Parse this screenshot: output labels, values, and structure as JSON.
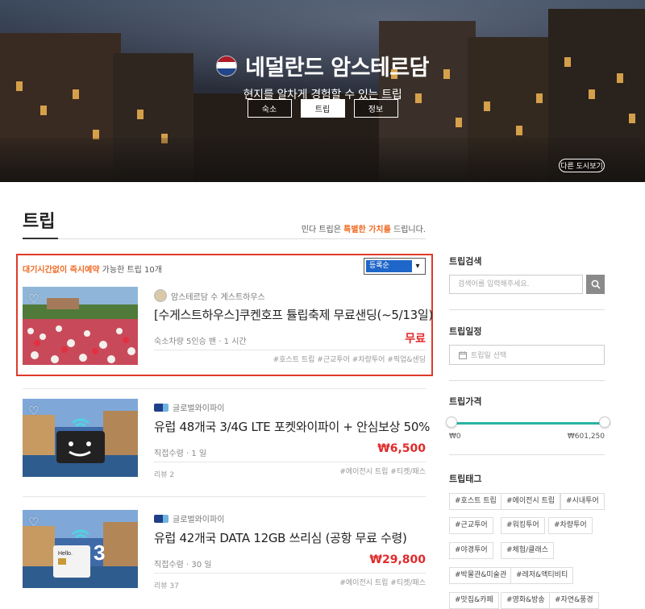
{
  "hero": {
    "city_name": "네덜란드 암스테르담",
    "subtitle": "현지를 알차게 경험할 수 있는 트립",
    "tabs": [
      {
        "label": "숙소",
        "active": false
      },
      {
        "label": "트립",
        "active": true
      },
      {
        "label": "정보",
        "active": false
      }
    ],
    "other_city": "다른 도시보기",
    "flag_colors": [
      "#ae1c28",
      "#ffffff",
      "#21468b"
    ]
  },
  "section": {
    "title": "트립",
    "note_prefix": "민다 트립은 ",
    "note_emphasis": "특별한 가치를",
    "note_suffix": " 드립니다."
  },
  "list": {
    "head_emphasis": "대기시간없이 즉시예약",
    "head_suffix": " 가능한 트립 10개",
    "sort_value": "등록순",
    "accent_color": "#f06a22",
    "highlight_border": "#e03a2a"
  },
  "items": [
    {
      "host": "암스테르담 수 게스트하우스",
      "title": "[수게스트하우스]쿠켄호프 튤립축제 무료샌딩(~5/13일)",
      "meta": "숙소차량 5인승 밴 · 1 시간",
      "price": "무료",
      "tags": "#호스트 트립  #근교투어  #차량투어  #픽업&샌딩",
      "review": ""
    },
    {
      "host": "글로벌와이파이",
      "title": "유럽 48개국 3/4G LTE 포켓와이파이 + 안심보상 50%",
      "meta": "직접수령 · 1 일",
      "price": "₩6,500",
      "tags": "#에이전시 트립  #티켓/패스",
      "review": "리뷰 2"
    },
    {
      "host": "글로벌와이파이",
      "title": "유럽 42개국 DATA 12GB 쓰리심 (공항 무료 수령)",
      "meta": "직접수령 · 30 일",
      "price": "₩29,800",
      "tags": "#에이전시 트립  #티켓/패스",
      "review": "리뷰 37"
    }
  ],
  "sidebar": {
    "search_title": "트립검색",
    "search_placeholder": "검색어를 입력해주세요.",
    "date_title": "트립일정",
    "date_placeholder": "트립일 선택",
    "price_title": "트립가격",
    "price_min": "₩0",
    "price_max": "₩601,250",
    "price_range_fraction": [
      0.0,
      1.0
    ],
    "slider_color": "#29b3a3",
    "tag_title": "트립태그",
    "tags": [
      "#호스트 트립",
      "#에이전시 트립",
      "#시내투어",
      "#근교투어",
      "#워킹투어",
      "#차량투어",
      "#야경투어",
      "#체험/클래스",
      "#박물관&미술관",
      "#레저&액티비티",
      "#맛집&카페",
      "#영화&방송",
      "#자연&풍경"
    ]
  }
}
